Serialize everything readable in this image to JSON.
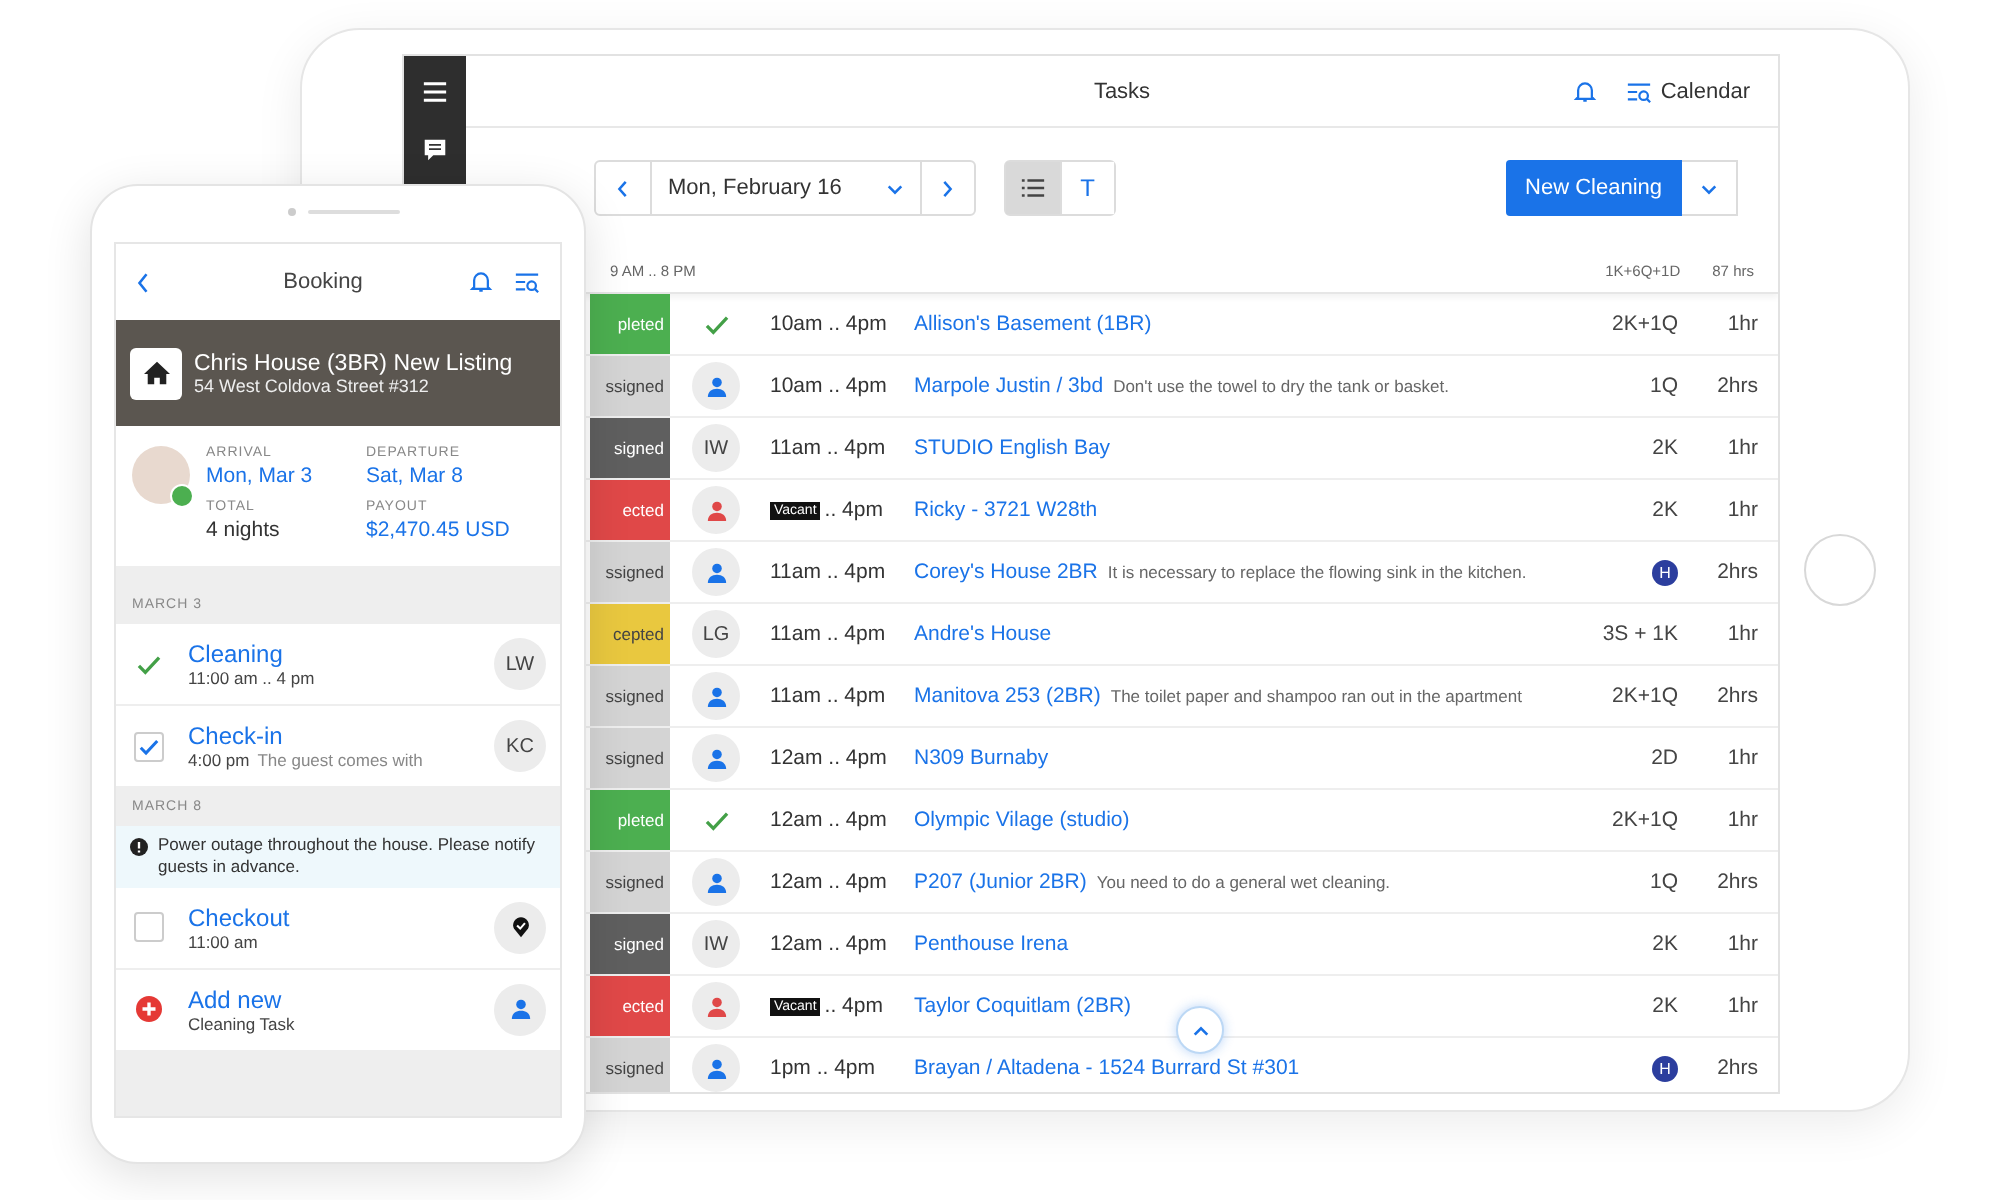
{
  "tablet": {
    "title": "Tasks",
    "calendar_label": "Calendar",
    "date": "Mon, February 16",
    "view_toggle": [
      {
        "kind": "icon",
        "selected": true
      },
      {
        "kind": "letter",
        "text": "T",
        "selected": false
      }
    ],
    "new_button": "New Cleaning",
    "range": "9 AM .. 8 PM",
    "total_units": "1K+6Q+1D",
    "total_hours": "87 hrs",
    "rows": [
      {
        "status": {
          "kind": "completed",
          "text": "pleted"
        },
        "assignee": {
          "kind": "check"
        },
        "time": "10am .. 4pm",
        "title": "Allison's Basement (1BR)",
        "size": {
          "kind": "text",
          "text": "2K+1Q"
        },
        "duration": "1hr"
      },
      {
        "status": {
          "kind": "unassigned",
          "text": "ssigned"
        },
        "assignee": {
          "kind": "person"
        },
        "time": "10am .. 4pm",
        "title": "Marpole Justin / 3bd",
        "note": "Don't use the towel to dry the tank or basket.",
        "size": {
          "kind": "text",
          "text": "1Q"
        },
        "duration": "2hrs"
      },
      {
        "status": {
          "kind": "assigned",
          "text": "signed"
        },
        "assignee": {
          "kind": "initials",
          "text": "IW"
        },
        "time": "11am .. 4pm",
        "title": "STUDIO English Bay",
        "size": {
          "kind": "text",
          "text": "2K"
        },
        "duration": "1hr"
      },
      {
        "status": {
          "kind": "rejected",
          "text": "ected"
        },
        "assignee": {
          "kind": "person-alert"
        },
        "badge": "Vacant",
        "time": ".. 4pm",
        "title": "Ricky - 3721 W28th",
        "size": {
          "kind": "text",
          "text": "2K"
        },
        "duration": "1hr"
      },
      {
        "status": {
          "kind": "unassigned",
          "text": "ssigned"
        },
        "assignee": {
          "kind": "person"
        },
        "time": "11am .. 4pm",
        "title": "Corey's House 2BR",
        "note": "It is necessary to replace the flowing sink in the kitchen.",
        "size": {
          "kind": "badge",
          "text": "H"
        },
        "duration": "2hrs"
      },
      {
        "status": {
          "kind": "accepted",
          "text": "cepted"
        },
        "assignee": {
          "kind": "initials",
          "text": "LG"
        },
        "time": "11am .. 4pm",
        "title": "Andre's House",
        "size": {
          "kind": "text",
          "text": "3S + 1K"
        },
        "duration": "1hr"
      },
      {
        "status": {
          "kind": "unassigned",
          "text": "ssigned"
        },
        "assignee": {
          "kind": "person"
        },
        "time": "11am .. 4pm",
        "title": "Manitova 253 (2BR)",
        "note": "The toilet paper and shampoo ran out in the apartment",
        "size": {
          "kind": "text",
          "text": "2K+1Q"
        },
        "duration": "2hrs"
      },
      {
        "status": {
          "kind": "unassigned",
          "text": "ssigned"
        },
        "assignee": {
          "kind": "person"
        },
        "time": "12am .. 4pm",
        "title": "N309 Burnaby",
        "size": {
          "kind": "text",
          "text": "2D"
        },
        "duration": "1hr"
      },
      {
        "status": {
          "kind": "completed",
          "text": "pleted"
        },
        "assignee": {
          "kind": "check"
        },
        "time": "12am .. 4pm",
        "title": "Olympic Vilage (studio)",
        "size": {
          "kind": "text",
          "text": "2K+1Q"
        },
        "duration": "1hr"
      },
      {
        "status": {
          "kind": "unassigned",
          "text": "ssigned"
        },
        "assignee": {
          "kind": "person"
        },
        "time": "12am .. 4pm",
        "title": "P207 (Junior 2BR)",
        "note": "You need to do a general wet cleaning.",
        "size": {
          "kind": "text",
          "text": "1Q"
        },
        "duration": "2hrs"
      },
      {
        "status": {
          "kind": "assigned",
          "text": "signed"
        },
        "assignee": {
          "kind": "initials",
          "text": "IW"
        },
        "time": "12am .. 4pm",
        "title": "Penthouse Irena",
        "size": {
          "kind": "text",
          "text": "2K"
        },
        "duration": "1hr"
      },
      {
        "status": {
          "kind": "rejected",
          "text": "ected"
        },
        "assignee": {
          "kind": "person-alert"
        },
        "badge": "Vacant",
        "time": ".. 4pm",
        "title": "Taylor Coquitlam (2BR)",
        "size": {
          "kind": "text",
          "text": "2K"
        },
        "duration": "1hr"
      },
      {
        "status": {
          "kind": "unassigned",
          "text": "ssigned"
        },
        "assignee": {
          "kind": "person"
        },
        "time": "1pm .. 4pm",
        "title": "Brayan / Altadena - 1524 Burrard St #301",
        "size": {
          "kind": "badge",
          "text": "H"
        },
        "duration": "2hrs"
      }
    ]
  },
  "phone": {
    "title": "Booking",
    "listing": {
      "name": "Chris House (3BR) New Listing",
      "address": "54 West Coldova Street #312"
    },
    "stay": [
      {
        "label": "ARRIVAL",
        "value": "Mon, Mar 3",
        "kind": "link"
      },
      {
        "label": "DEPARTURE",
        "value": "Sat, Mar 8",
        "kind": "link"
      },
      {
        "label": "TOTAL",
        "value": "4 nights",
        "kind": "plain"
      },
      {
        "label": "PAYOUT",
        "value": "$2,470.45 USD",
        "kind": "link"
      }
    ],
    "sections": [
      {
        "heading": "MARCH 3",
        "items": [
          {
            "kind": "done",
            "title": "Cleaning",
            "time": "11:00 am .. 4 pm",
            "trailing": {
              "kind": "initials",
              "text": "LW"
            }
          },
          {
            "kind": "checkbox",
            "checked": true,
            "title": "Check-in",
            "time": "4:00 pm",
            "note": "The guest comes with",
            "trailing": {
              "kind": "initials",
              "text": "KC"
            }
          }
        ]
      },
      {
        "heading": "MARCH 8",
        "alert": "Power outage throughout the house. Please notify guests in advance.",
        "items": [
          {
            "kind": "checkbox",
            "checked": false,
            "title": "Checkout",
            "time": "11:00 am",
            "trailing": {
              "kind": "pin"
            }
          },
          {
            "kind": "add",
            "title": "Add new",
            "time": "Cleaning Task",
            "trailing": {
              "kind": "person"
            }
          }
        ]
      }
    ]
  }
}
